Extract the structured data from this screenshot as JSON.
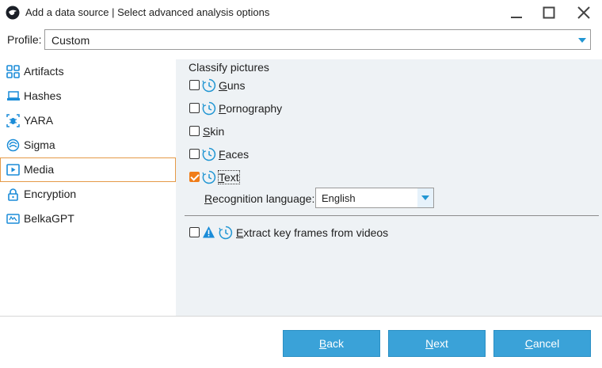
{
  "window": {
    "title": "Add a data source | Select advanced analysis options",
    "icons": {
      "app": "belkasoft-logo-icon",
      "minimize": "minimize-icon",
      "maximize": "maximize-icon",
      "close": "close-icon"
    }
  },
  "profile": {
    "label": "Profile:",
    "value": "Custom"
  },
  "sidebar": {
    "items": [
      {
        "label": "Artifacts",
        "icon": "grid-icon",
        "active": false
      },
      {
        "label": "Hashes",
        "icon": "hash-icon",
        "active": false
      },
      {
        "label": "YARA",
        "icon": "yara-bug-icon",
        "active": false
      },
      {
        "label": "Sigma",
        "icon": "sigma-icon",
        "active": false
      },
      {
        "label": "Media",
        "icon": "media-play-icon",
        "active": true
      },
      {
        "label": "Encryption",
        "icon": "lock-icon",
        "active": false
      },
      {
        "label": "BelkaGPT",
        "icon": "belkagpt-icon",
        "active": false
      }
    ]
  },
  "classify": {
    "title": "Classify pictures",
    "options": [
      {
        "key": "G",
        "rest": "uns",
        "checked": false
      },
      {
        "key": "P",
        "rest": "ornography",
        "checked": false
      },
      {
        "key": "S",
        "rest": "kin",
        "checked": false
      },
      {
        "key": "F",
        "rest": "aces",
        "checked": false
      },
      {
        "key": "T",
        "rest": "ext",
        "checked": true
      }
    ],
    "recognition": {
      "key": "R",
      "rest": "ecognition language:",
      "value": "English"
    }
  },
  "keyframes": {
    "key": "E",
    "rest": "xtract key frames from videos",
    "checked": false
  },
  "buttons": {
    "back": {
      "key": "B",
      "rest": "ack"
    },
    "next": {
      "key": "N",
      "rest": "ext"
    },
    "cancel": {
      "key": "C",
      "rest": "ancel"
    }
  },
  "colors": {
    "accent": "#3aa2d8",
    "checkbox_checked": "#f07d1a",
    "active_border": "#e59a47",
    "icon_blue": "#2196d3",
    "content_bg": "#eef2f5"
  }
}
